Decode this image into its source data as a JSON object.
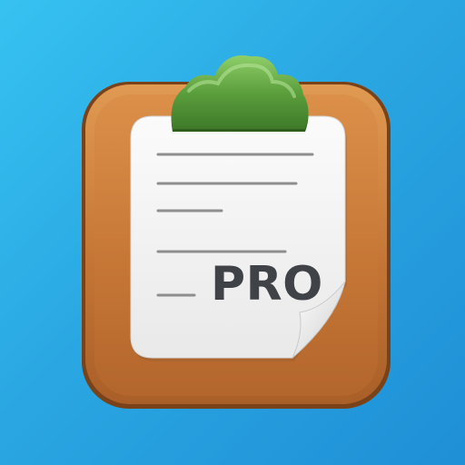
{
  "app_icon": {
    "badge_text": "PRO",
    "icons": {
      "board": "clipboard-board-icon",
      "clip": "green-cloud-clip-icon",
      "paper": "note-paper-icon",
      "curl": "page-curl-icon"
    },
    "colors": {
      "background": "#2aa7e2",
      "board": "#c97b3c",
      "board_dark": "#8a4c20",
      "clip": "#5a9e3c",
      "paper": "#f3f3f3",
      "line": "#8a8a8a",
      "badge_text": "#3f4347"
    }
  }
}
